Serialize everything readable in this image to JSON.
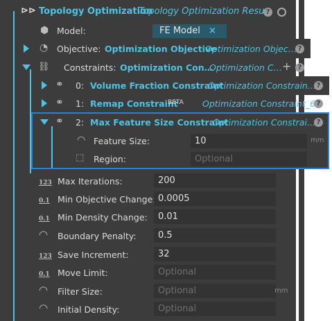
{
  "header": {
    "title": "Topology Optimization",
    "subtitle": "Topology Optimization Resu…"
  },
  "model": {
    "label": "Model:",
    "value": "FE Model"
  },
  "objective": {
    "label": "Objective:",
    "name": "Optimization Objective",
    "ref": "Optimization Objec…"
  },
  "constraints": {
    "label": "Constraints:",
    "name": "Optimization Con…",
    "ref": "Optimization C…",
    "add": "+",
    "items": [
      {
        "index": "0:",
        "name": "Volume Fraction Constraint",
        "ref": "Optimization Constrain…"
      },
      {
        "index": "1:",
        "name": "Remap Constraint",
        "badge": "BETA",
        "ref": "Optimization Constraint_6"
      },
      {
        "index": "2:",
        "name": "Max Feature Size Constraint",
        "ref": "Optimization Constrai…",
        "feature_size_label": "Feature Size:",
        "feature_size_value": "10",
        "feature_size_unit": "mm",
        "region_label": "Region:",
        "region_placeholder": "Optional"
      }
    ]
  },
  "params": [
    {
      "icon": "123",
      "label": "Max Iterations:",
      "value": "200"
    },
    {
      "icon": "0.1",
      "label": "Min Objective Change:",
      "value": "0.0005"
    },
    {
      "icon": "0.1",
      "label": "Min Density Change:",
      "value": "0.01"
    },
    {
      "icon": "radio",
      "label": "Boundary Penalty:",
      "value": "0.5"
    },
    {
      "icon": "123",
      "label": "Save Increment:",
      "value": "32"
    },
    {
      "icon": "0.1",
      "label": "Move Limit:",
      "placeholder": "Optional"
    },
    {
      "icon": "radio",
      "label": "Filter Size:",
      "placeholder": "Optional",
      "unit": "mm"
    },
    {
      "icon": "radio",
      "label": "Initial Density:",
      "placeholder": "Optional"
    }
  ],
  "colors": {
    "accent": "#4fc3e3",
    "panel": "#3c3c3c",
    "field": "#333333",
    "highlight": "#2e7fd6"
  }
}
